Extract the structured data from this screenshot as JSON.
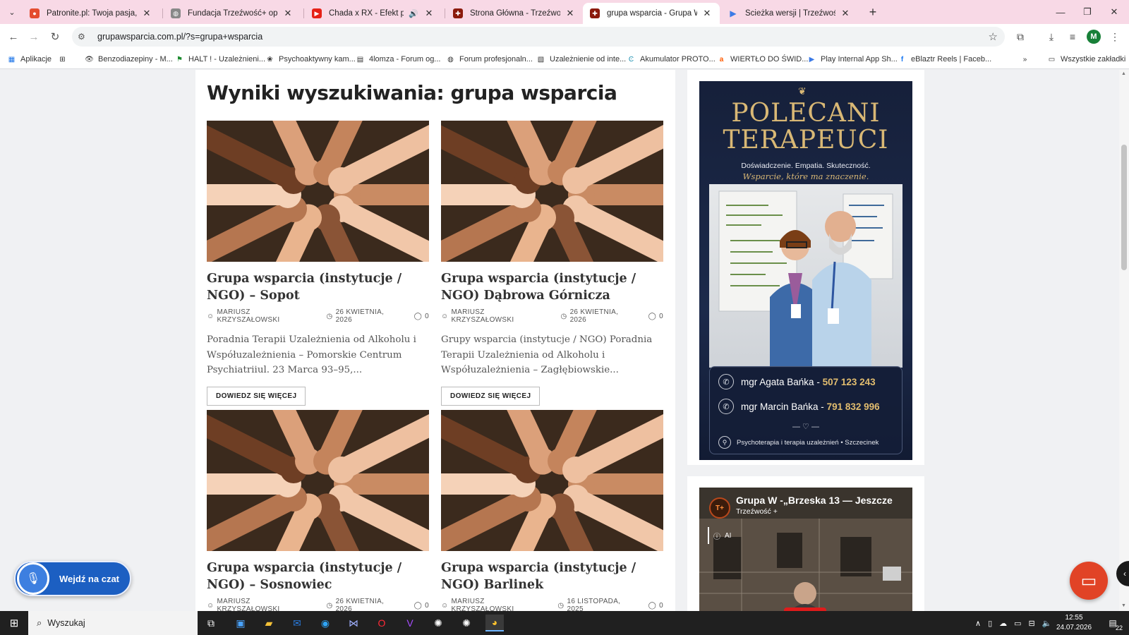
{
  "browser": {
    "tabs": [
      {
        "title": "Patronite.pl: Twoja pasja, Twoje",
        "favicon": "patronite-icon",
        "active": false
      },
      {
        "title": "Fundacja Trzeźwość+ opis",
        "favicon": "globe-icon",
        "active": false
      },
      {
        "title": "Chada x RX - Efekt porozum",
        "favicon": "youtube-icon",
        "active": false,
        "audio": true
      },
      {
        "title": "Strona Główna - Trzeźwość+",
        "favicon": "site-icon",
        "active": false
      },
      {
        "title": "grupa wsparcia - Grupa Wsparc",
        "favicon": "site-icon",
        "active": true
      },
      {
        "title": "Ścieżka wersji | Trzeźwość+",
        "favicon": "play-icon",
        "active": false
      }
    ],
    "url": "grupawsparcia.com.pl/?s=grupa+wsparcia",
    "profile_initial": "M",
    "bookmarks": [
      {
        "label": "Aplikacje",
        "icon": "apps-grid-icon"
      },
      {
        "label": "",
        "icon": "tab-groups-icon"
      },
      {
        "label": "Benzodiazepiny - M...",
        "icon": "eye-icon"
      },
      {
        "label": "HALT ! - Uzależnieni...",
        "icon": "flag-icon"
      },
      {
        "label": "Psychoaktywny kam...",
        "icon": "leaf-icon"
      },
      {
        "label": "4lomza - Forum og...",
        "icon": "forum-icon"
      },
      {
        "label": "Forum profesjonaln...",
        "icon": "globe-icon"
      },
      {
        "label": "Uzależnienie od inte...",
        "icon": "image-icon"
      },
      {
        "label": "Akumulator PROTO...",
        "icon": "c-logo-icon"
      },
      {
        "label": "WIERTŁO DO ŚWID...",
        "icon": "allegro-icon"
      },
      {
        "label": "Play Internal App Sh...",
        "icon": "play-icon"
      },
      {
        "label": "eBlaztr Reels | Faceb...",
        "icon": "facebook-icon"
      }
    ],
    "all_bookmarks": "Wszystkie zakładki"
  },
  "page": {
    "title": "Wyniki wyszukiwania: grupa wsparcia",
    "posts": [
      {
        "title": "Grupa wsparcia (instytucje / NGO) – Sopot",
        "author": "MARIUSZ KRZYSZAŁOWSKI",
        "date": "26 KWIETNIA, 2026",
        "comments": "0",
        "excerpt": "Poradnia Terapii Uzależnienia od Alkoholu i Współuzależnienia – Pomorskie Centrum Psychiatriiul. 23 Marca 93–95,...",
        "button": "DOWIEDZ SIĘ WIĘCEJ"
      },
      {
        "title": "Grupa wsparcia (instytucje / NGO) Dąbrowa Górnicza",
        "author": "MARIUSZ KRZYSZAŁOWSKI",
        "date": "26 KWIETNIA, 2026",
        "comments": "0",
        "excerpt": "Grupy wsparcia (instytucje / NGO) Poradnia Terapii Uzależnienia od Alkoholu i Współuzależnienia – Zagłębiowskie...",
        "button": "DOWIEDZ SIĘ WIĘCEJ"
      },
      {
        "title": "Grupa wsparcia (instytucje / NGO) – Sosnowiec",
        "author": "MARIUSZ KRZYSZAŁOWSKI",
        "date": "26 KWIETNIA, 2026",
        "comments": "0"
      },
      {
        "title": "Grupa wsparcia (instytucje / NGO) Barlinek",
        "author": "MARIUSZ KRZYSZAŁOWSKI",
        "date": "16 LISTOPADA, 2025",
        "comments": "0"
      }
    ]
  },
  "ad": {
    "title_line1": "POLECANI",
    "title_line2": "TERAPEUCI",
    "subtitle": "Doświadczenie. Empatia. Skuteczność.",
    "script": "Wsparcie, które ma znaczenie.",
    "contacts": [
      {
        "name": "mgr Agata Bańka - ",
        "phone": "507 123 243"
      },
      {
        "name": "mgr Marcin Bańka - ",
        "phone": "791 832 996"
      }
    ],
    "footer": "Psychoterapia i terapia uzależnień • Szczecinek"
  },
  "video": {
    "title": "Grupa W -„Brzeska 13 — Jeszcze",
    "channel": "Trzeźwość +",
    "ai_label": "AI"
  },
  "widgets": {
    "chat_pill": "Wejdź na czat"
  },
  "taskbar": {
    "search_placeholder": "Wyszukaj",
    "time": "12:55",
    "date": "24.07.2026",
    "notifications": "22"
  },
  "colors": {
    "tabbar": "#f8d9e6",
    "ad_gold": "#d9b875",
    "ad_bg": "#1c2a4b",
    "chat_blue": "#1c5fc2",
    "chat_red": "#e14326"
  }
}
